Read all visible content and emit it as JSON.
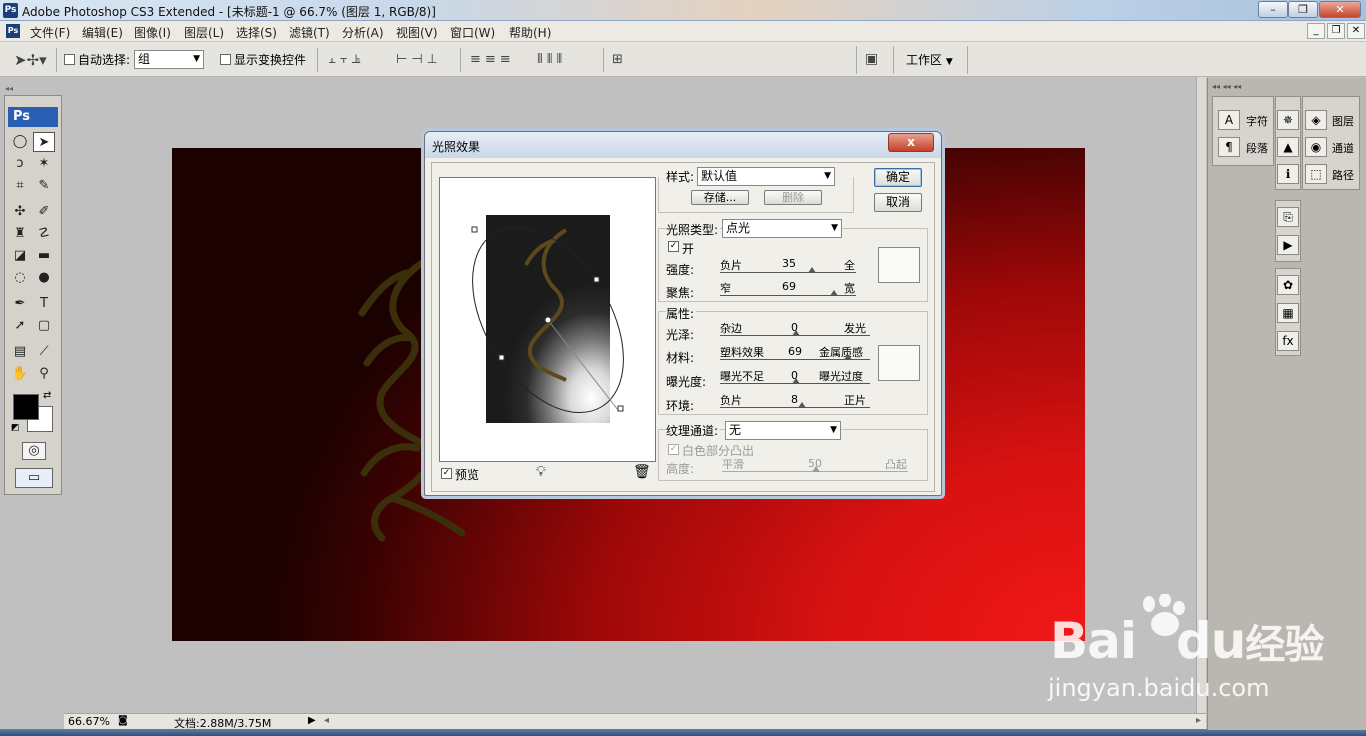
{
  "window": {
    "title": "Adobe Photoshop CS3 Extended - [未标题-1 @ 66.7% (图层 1, RGB/8)]",
    "app_badge": "Ps"
  },
  "menu": [
    "文件(F)",
    "编辑(E)",
    "图像(I)",
    "图层(L)",
    "选择(S)",
    "滤镜(T)",
    "分析(A)",
    "视图(V)",
    "窗口(W)",
    "帮助(H)"
  ],
  "options": {
    "auto_select_label": "自动选择:",
    "auto_select_value": "组",
    "show_transform_label": "显示变换控件",
    "workspace_label": "工作区"
  },
  "toolbox": {
    "logo": "Ps"
  },
  "status": {
    "zoom": "66.67%",
    "doc_info": "文档:2.88M/3.75M"
  },
  "panels": {
    "character": "字符",
    "paragraph": "段落",
    "layers": "图层",
    "channels": "通道",
    "paths": "路径"
  },
  "dialog": {
    "title": "光照效果",
    "close": "x",
    "style_label": "样式:",
    "style_value": "默认值",
    "save_btn": "存储...",
    "delete_btn": "删除",
    "ok_btn": "确定",
    "cancel_btn": "取消",
    "light_type_label": "光照类型:",
    "light_type_value": "点光",
    "on_label": "开",
    "intensity": {
      "label": "强度:",
      "min": "负片",
      "max": "全",
      "value": "35"
    },
    "focus": {
      "label": "聚焦:",
      "min": "窄",
      "max": "宽",
      "value": "69"
    },
    "properties_label": "属性:",
    "gloss": {
      "label": "光泽:",
      "min": "杂边",
      "max": "发光",
      "value": "0"
    },
    "material": {
      "label": "材料:",
      "min": "塑料效果",
      "max": "金属质感",
      "value": "69"
    },
    "exposure": {
      "label": "曝光度:",
      "min": "曝光不足",
      "max": "曝光过度",
      "value": "0"
    },
    "ambience": {
      "label": "环境:",
      "min": "负片",
      "max": "正片",
      "value": "8"
    },
    "texture_label": "纹理通道:",
    "texture_value": "无",
    "white_high_label": "白色部分凸出",
    "height": {
      "label": "高度:",
      "min": "平滑",
      "max": "凸起",
      "value": "50"
    },
    "preview_label": "预览"
  },
  "watermark": {
    "line1": "Bai",
    "line1b": "du",
    "line1c": "经验",
    "line2": "jingyan.baidu.com"
  }
}
